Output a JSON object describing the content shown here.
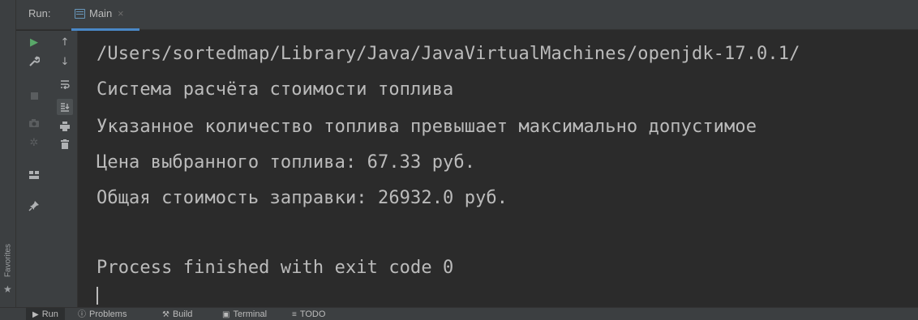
{
  "favorites": {
    "label": "Favorites",
    "star_icon": "star-icon"
  },
  "run_panel": {
    "title": "Run:",
    "tab": {
      "label": "Main",
      "close": "×",
      "icon": "console-icon"
    }
  },
  "toolbar": {
    "left": [
      "run-icon",
      "wrench-icon",
      "stop-icon",
      "camera-icon",
      "debug-icon",
      "layout-icon",
      "pin-icon"
    ],
    "right": [
      "up-arrow-icon",
      "down-arrow-icon",
      "soft-wrap-icon",
      "scroll-to-end-icon",
      "print-icon",
      "trash-icon"
    ]
  },
  "console": {
    "lines": [
      "/Users/sortedmap/Library/Java/JavaVirtualMachines/openjdk-17.0.1/",
      "Система расчёта стоимости топлива",
      "Указанное количество топлива превышает максимально допустимое",
      "Цена выбранного топлива: 67.33 руб.",
      "Общая стоимость заправки: 26932.0 руб.",
      "",
      "Process finished with exit code 0"
    ]
  },
  "statusbar": {
    "items": [
      {
        "label": "Run",
        "icon": "play-icon"
      },
      {
        "label": "Problems",
        "icon": "info-icon"
      },
      {
        "label": "Build",
        "icon": "hammer-icon"
      },
      {
        "label": "Terminal",
        "icon": "terminal-icon"
      },
      {
        "label": "TODO",
        "icon": "list-icon"
      }
    ]
  }
}
